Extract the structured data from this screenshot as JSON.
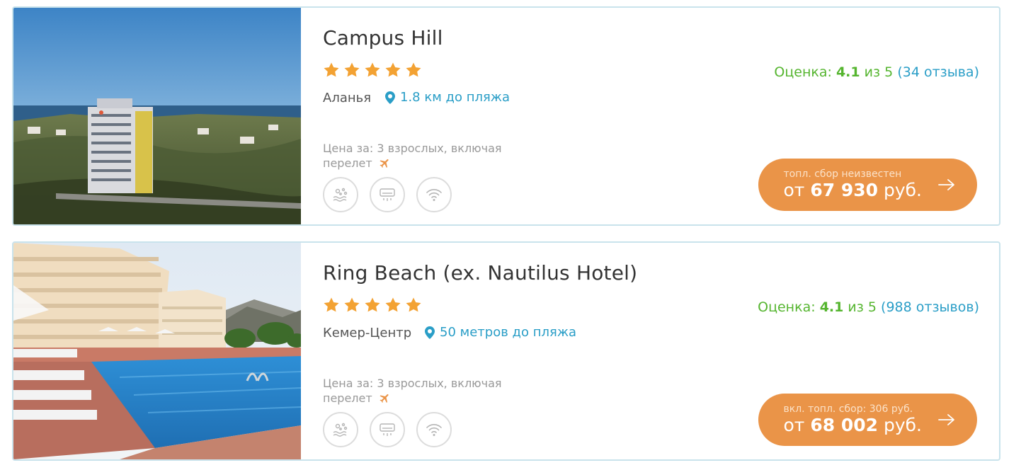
{
  "colors": {
    "border": "#c9e3ec",
    "star": "#f3a233",
    "rating_green": "#55b52f",
    "link_blue": "#2a9ec7",
    "button_orange": "#ea9448"
  },
  "hotels": [
    {
      "name": "Campus Hill",
      "stars": 5,
      "city": "Аланья",
      "beach": "1.8 км до пляжа",
      "price_note": "Цена за: 3 взрослых, включая перелет",
      "rating_label": "Оценка:",
      "rating_value": "4.1",
      "rating_scale": "из 5",
      "reviews": "(34 отзыва)",
      "fee": "топл. сбор неизвестен",
      "price_prefix": "от",
      "price": "67 930",
      "currency": "руб.",
      "amenity_icons": [
        "beach-icon",
        "air-conditioner-icon",
        "wifi-icon"
      ],
      "photo": "hotel-tower-sea-view-image"
    },
    {
      "name": "Ring Beach (ex. Nautilus Hotel)",
      "stars": 5,
      "city": "Кемер-Центр",
      "beach": "50 метров до пляжа",
      "price_note": "Цена за: 3 взрослых, включая перелет",
      "rating_label": "Оценка:",
      "rating_value": "4.1",
      "rating_scale": "из 5",
      "reviews": "(988 отзывов)",
      "fee": "вкл. топл. сбор: 306 руб.",
      "price_prefix": "от",
      "price": "68 002",
      "currency": "руб.",
      "amenity_icons": [
        "beach-icon",
        "air-conditioner-icon",
        "wifi-icon"
      ],
      "photo": "hotel-pool-mountains-image"
    }
  ]
}
